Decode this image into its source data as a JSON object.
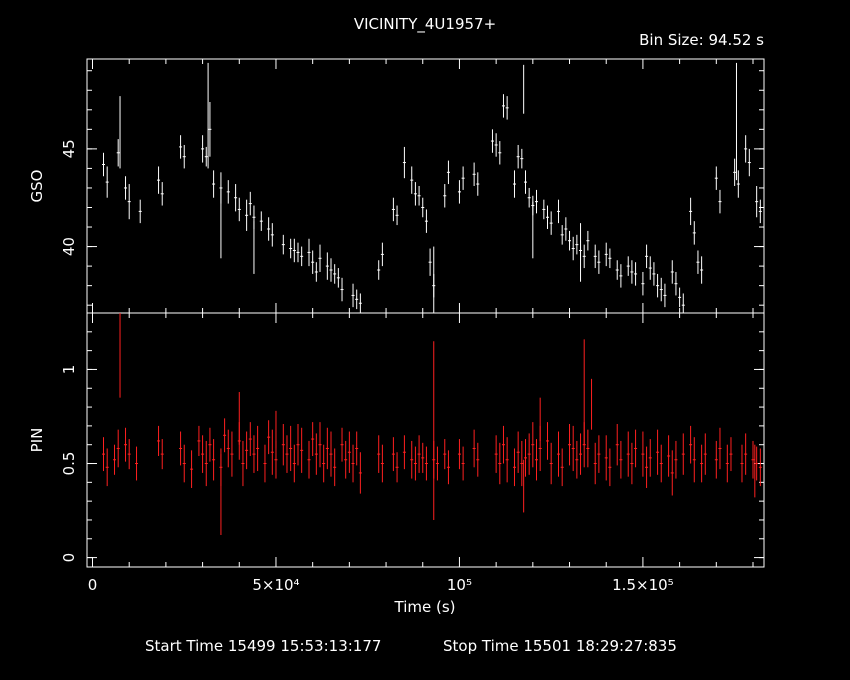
{
  "title": "VICINITY_4U1957+",
  "bin_size": "Bin Size: 94.52 s",
  "footer": {
    "start": "Start Time 15499 15:53:13:177",
    "stop": "Stop Time 15501 18:29:27:835"
  },
  "chart_data": [
    {
      "type": "scatter",
      "ylabel": "GSO",
      "series_color": "#ffffff",
      "ylim": [
        36.6,
        49.6
      ],
      "xlim": [
        -1500,
        183000
      ],
      "ytick_values": [
        40,
        45
      ],
      "ytick_labels": [
        "40",
        "45"
      ],
      "x": [
        3000,
        4000,
        7000,
        9000,
        10000,
        13000,
        18000,
        19000,
        24000,
        25000,
        30000,
        31000,
        32000,
        33000,
        35000,
        37000,
        39000,
        40000,
        42000,
        43000,
        44000,
        46000,
        48000,
        49000,
        52000,
        54000,
        55000,
        56000,
        57000,
        59000,
        60000,
        61000,
        62000,
        64000,
        65000,
        66000,
        67000,
        68000,
        71000,
        72000,
        73000,
        78000,
        79000,
        82000,
        83000,
        85000,
        87000,
        88000,
        89000,
        90000,
        91000,
        92000,
        93000,
        96000,
        97000,
        100000,
        101000,
        104000,
        105000,
        109000,
        110000,
        111000,
        112000,
        113000,
        115000,
        116000,
        117000,
        118000,
        119000,
        120000,
        121000,
        123000,
        124000,
        125000,
        127000,
        128000,
        129000,
        130000,
        131000,
        132000,
        133000,
        134000,
        135000,
        137000,
        138000,
        140000,
        141000,
        143000,
        144000,
        146000,
        147000,
        148000,
        150000,
        151000,
        152000,
        153000,
        154000,
        155000,
        156000,
        158000,
        159000,
        160000,
        161000,
        163000,
        164000,
        165000,
        166000,
        170000,
        171000,
        175000,
        176000,
        178000,
        179000,
        181000,
        182000
      ],
      "y": [
        44.2,
        43.3,
        44.8,
        43.0,
        42.3,
        41.8,
        43.4,
        42.7,
        45.1,
        44.6,
        45.0,
        44.6,
        46.0,
        43.2,
        43.0,
        42.8,
        42.5,
        41.9,
        41.6,
        42.2,
        41.5,
        41.3,
        40.9,
        40.6,
        40.1,
        39.9,
        39.8,
        39.7,
        39.5,
        39.7,
        39.2,
        38.7,
        39.4,
        39.0,
        38.8,
        38.6,
        38.4,
        37.8,
        37.5,
        37.3,
        37.1,
        38.8,
        39.6,
        41.9,
        41.6,
        44.3,
        43.4,
        42.7,
        42.6,
        42.0,
        41.3,
        39.2,
        38.0,
        42.6,
        43.8,
        42.8,
        43.5,
        43.7,
        43.2,
        45.4,
        45.2,
        44.8,
        47.2,
        47.1,
        43.2,
        44.6,
        44.5,
        43.3,
        42.5,
        42.1,
        42.3,
        41.9,
        41.5,
        41.2,
        41.8,
        40.6,
        40.9,
        40.3,
        39.9,
        40.1,
        39.8,
        39.5,
        40.3,
        39.5,
        39.2,
        39.6,
        39.4,
        38.8,
        38.5,
        39.0,
        38.7,
        38.6,
        38.1,
        39.5,
        38.9,
        38.6,
        38.0,
        37.8,
        37.5,
        38.7,
        38.1,
        37.4,
        37.0,
        41.8,
        40.7,
        39.2,
        38.8,
        43.5,
        42.3,
        43.8,
        43.2,
        45.0,
        44.3,
        42.3,
        41.8
      ],
      "yerr": [
        0.6,
        0.8,
        0.7,
        0.6,
        0.9,
        0.6,
        0.7,
        0.6,
        0.6,
        0.6,
        0.7,
        0.5,
        1.4,
        0.7,
        0.8,
        0.6,
        0.7,
        0.6,
        0.8,
        0.6,
        0.6,
        0.5,
        0.6,
        0.6,
        0.5,
        0.5,
        0.6,
        0.5,
        0.5,
        0.7,
        0.6,
        0.5,
        0.7,
        0.7,
        0.6,
        0.5,
        0.5,
        0.6,
        0.6,
        0.5,
        0.5,
        0.5,
        0.6,
        0.6,
        0.5,
        0.8,
        0.7,
        0.6,
        0.5,
        0.5,
        0.6,
        0.7,
        0.6,
        0.6,
        0.6,
        0.6,
        0.6,
        0.6,
        0.6,
        0.6,
        0.6,
        0.6,
        0.6,
        0.6,
        0.7,
        0.6,
        0.5,
        0.6,
        0.5,
        0.5,
        0.6,
        0.5,
        0.6,
        0.6,
        0.6,
        0.5,
        0.6,
        0.5,
        0.6,
        0.5,
        0.5,
        0.6,
        0.5,
        0.6,
        0.6,
        0.6,
        0.5,
        0.5,
        0.6,
        0.5,
        0.6,
        0.6,
        0.6,
        0.6,
        0.6,
        0.6,
        0.6,
        0.6,
        0.6,
        0.6,
        0.6,
        0.5,
        0.6,
        0.7,
        0.6,
        0.6,
        0.7,
        0.6,
        0.6,
        0.7,
        0.7,
        0.7,
        0.7,
        0.8,
        0.6
      ],
      "spikes": [
        {
          "x": 7500,
          "low": 44.0,
          "high": 47.7
        },
        {
          "x": 31500,
          "low": 44.0,
          "high": 49.4
        },
        {
          "x": 35000,
          "low": 39.4,
          "high": 43.0
        },
        {
          "x": 44000,
          "low": 38.6,
          "high": 41.3
        },
        {
          "x": 93000,
          "low": 36.6,
          "high": 40.0
        },
        {
          "x": 117500,
          "low": 46.8,
          "high": 49.3
        },
        {
          "x": 120000,
          "low": 39.4,
          "high": 42.3
        },
        {
          "x": 133000,
          "low": 38.2,
          "high": 41.2
        },
        {
          "x": 175500,
          "low": 43.4,
          "high": 49.4
        }
      ]
    },
    {
      "type": "scatter",
      "ylabel": "PIN",
      "xlabel": "Time (s)",
      "series_color": "#ff2020",
      "ylim": [
        -0.05,
        1.3
      ],
      "xlim": [
        -1500,
        183000
      ],
      "ytick_values": [
        0,
        0.5,
        1
      ],
      "ytick_labels": [
        "0",
        "0.5",
        "1"
      ],
      "xtick_values": [
        0,
        50000,
        100000,
        150000
      ],
      "xtick_labels": [
        "0",
        "5×10⁴",
        "10⁵",
        "1.5×10⁵"
      ],
      "x": [
        3000,
        4000,
        6000,
        7000,
        9000,
        10000,
        12000,
        18000,
        19000,
        24000,
        25000,
        27000,
        29000,
        30000,
        31000,
        32000,
        33000,
        35000,
        36000,
        37000,
        38000,
        40000,
        41000,
        42000,
        43000,
        44000,
        45000,
        47000,
        48000,
        49000,
        50000,
        52000,
        53000,
        54000,
        55000,
        56000,
        57000,
        59000,
        60000,
        61000,
        62000,
        63000,
        64000,
        65000,
        66000,
        68000,
        69000,
        70000,
        71000,
        72000,
        73000,
        78000,
        79000,
        82000,
        83000,
        85000,
        87000,
        88000,
        89000,
        90000,
        91000,
        93000,
        94000,
        96000,
        97000,
        100000,
        101000,
        104000,
        105000,
        110000,
        111000,
        112000,
        113000,
        115000,
        116000,
        117000,
        118000,
        119000,
        120000,
        121000,
        122000,
        124000,
        125000,
        127000,
        128000,
        130000,
        131000,
        132000,
        133000,
        134000,
        135000,
        137000,
        138000,
        140000,
        141000,
        143000,
        144000,
        146000,
        147000,
        148000,
        150000,
        151000,
        152000,
        154000,
        155000,
        157000,
        158000,
        159000,
        161000,
        163000,
        164000,
        166000,
        167000,
        170000,
        171000,
        173000,
        174000,
        177000,
        178000,
        180000,
        181000,
        182000
      ],
      "y": [
        0.55,
        0.48,
        0.52,
        0.58,
        0.6,
        0.55,
        0.5,
        0.62,
        0.55,
        0.58,
        0.5,
        0.47,
        0.62,
        0.55,
        0.5,
        0.6,
        0.52,
        0.48,
        0.65,
        0.58,
        0.55,
        0.62,
        0.5,
        0.57,
        0.63,
        0.55,
        0.58,
        0.5,
        0.64,
        0.56,
        0.52,
        0.6,
        0.55,
        0.58,
        0.5,
        0.6,
        0.57,
        0.52,
        0.63,
        0.55,
        0.6,
        0.5,
        0.58,
        0.55,
        0.48,
        0.6,
        0.52,
        0.56,
        0.5,
        0.58,
        0.45,
        0.55,
        0.5,
        0.55,
        0.48,
        0.56,
        0.52,
        0.5,
        0.55,
        0.53,
        0.5,
        0.52,
        0.5,
        0.55,
        0.48,
        0.55,
        0.5,
        0.58,
        0.52,
        0.55,
        0.5,
        0.6,
        0.52,
        0.48,
        0.56,
        0.5,
        0.53,
        0.55,
        0.6,
        0.52,
        0.58,
        0.62,
        0.5,
        0.55,
        0.48,
        0.6,
        0.58,
        0.52,
        0.55,
        0.6,
        0.58,
        0.5,
        0.55,
        0.53,
        0.48,
        0.6,
        0.52,
        0.55,
        0.5,
        0.58,
        0.55,
        0.48,
        0.53,
        0.56,
        0.5,
        0.54,
        0.45,
        0.52,
        0.55,
        0.6,
        0.52,
        0.5,
        0.55,
        0.52,
        0.58,
        0.5,
        0.55,
        0.5,
        0.55,
        0.52,
        0.5,
        0.48
      ],
      "yerr": [
        0.09,
        0.1,
        0.08,
        0.1,
        0.09,
        0.08,
        0.09,
        0.08,
        0.08,
        0.09,
        0.1,
        0.1,
        0.08,
        0.1,
        0.12,
        0.09,
        0.11,
        0.1,
        0.09,
        0.1,
        0.12,
        0.1,
        0.12,
        0.1,
        0.09,
        0.1,
        0.12,
        0.1,
        0.09,
        0.12,
        0.1,
        0.11,
        0.1,
        0.12,
        0.1,
        0.11,
        0.12,
        0.1,
        0.09,
        0.11,
        0.12,
        0.1,
        0.11,
        0.12,
        0.1,
        0.09,
        0.1,
        0.11,
        0.1,
        0.09,
        0.11,
        0.1,
        0.1,
        0.09,
        0.08,
        0.09,
        0.1,
        0.09,
        0.1,
        0.08,
        0.09,
        0.1,
        0.09,
        0.08,
        0.09,
        0.08,
        0.09,
        0.1,
        0.09,
        0.1,
        0.11,
        0.1,
        0.12,
        0.1,
        0.11,
        0.12,
        0.1,
        0.11,
        0.12,
        0.11,
        0.12,
        0.1,
        0.11,
        0.12,
        0.1,
        0.11,
        0.12,
        0.1,
        0.11,
        0.12,
        0.1,
        0.11,
        0.1,
        0.12,
        0.1,
        0.11,
        0.1,
        0.12,
        0.11,
        0.1,
        0.12,
        0.11,
        0.1,
        0.12,
        0.1,
        0.11,
        0.12,
        0.1,
        0.11,
        0.1,
        0.12,
        0.1,
        0.11,
        0.1,
        0.11,
        0.1,
        0.09,
        0.1,
        0.11,
        0.1,
        0.09,
        0.1
      ],
      "spikes": [
        {
          "x": 7500,
          "low": 0.85,
          "high": 1.3
        },
        {
          "x": 35000,
          "low": 0.12,
          "high": 0.55
        },
        {
          "x": 40000,
          "low": 0.6,
          "high": 0.88
        },
        {
          "x": 50000,
          "low": 0.58,
          "high": 0.78
        },
        {
          "x": 93000,
          "low": 0.2,
          "high": 1.15
        },
        {
          "x": 117500,
          "low": 0.24,
          "high": 0.52
        },
        {
          "x": 122000,
          "low": 0.62,
          "high": 0.85
        },
        {
          "x": 134000,
          "low": 0.6,
          "high": 1.16
        },
        {
          "x": 136000,
          "low": 0.68,
          "high": 0.95
        },
        {
          "x": 180500,
          "low": 0.32,
          "high": 0.6
        }
      ]
    }
  ]
}
